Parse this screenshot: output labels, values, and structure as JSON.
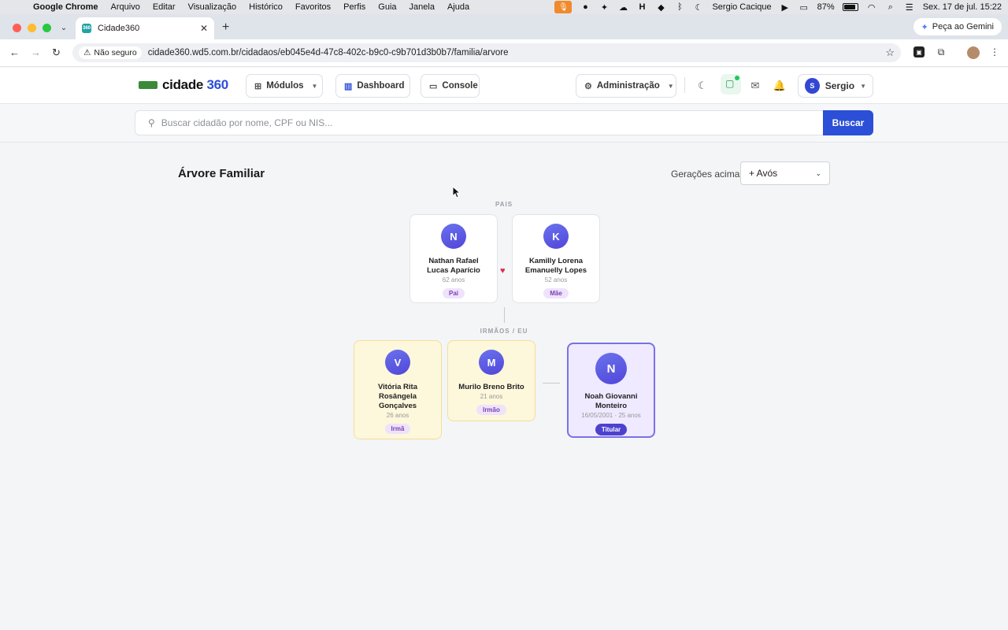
{
  "menubar": {
    "app": "Google Chrome",
    "items": [
      "Arquivo",
      "Editar",
      "Visualização",
      "Histórico",
      "Favoritos",
      "Perfis",
      "Guia",
      "Janela",
      "Ajuda"
    ],
    "user": "Sergio Cacique",
    "battery": "87%",
    "datetime": "Sex. 17 de jul.  15:22"
  },
  "browser": {
    "tab_title": "Cidade360",
    "tab_favicon": "360",
    "gemini": "Peça ao Gemini",
    "not_secure": "Não seguro",
    "url": "cidade360.wd5.com.br/cidadaos/eb045e4d-47c8-402c-b9c0-c9b701d3b0b7/familia/arvore"
  },
  "header": {
    "logo_main": "cidade",
    "logo_num": "360",
    "modules": "Módulos",
    "dashboard": "Dashboard",
    "console": "Console",
    "admin": "Administração",
    "user_initial": "S",
    "user_name": "Sergio"
  },
  "search": {
    "placeholder": "Buscar cidadão por nome, CPF ou NIS...",
    "button": "Buscar"
  },
  "tree": {
    "title": "Árvore Familiar",
    "generations_label": "Gerações acima:",
    "generations_value": "+ Avós",
    "parents_label": "PAIS",
    "siblings_label": "IRMÃOS / EU",
    "parents": [
      {
        "initial": "N",
        "name": "Nathan Rafael Lucas Aparício",
        "age": "62 anos",
        "role": "Pai"
      },
      {
        "initial": "K",
        "name": "Kamilly Lorena Emanuelly Lopes",
        "age": "52 anos",
        "role": "Mãe"
      }
    ],
    "siblings": [
      {
        "initial": "V",
        "name": "Vitória Rita Rosângela Gonçalves",
        "age": "26 anos",
        "role": "Irmã"
      },
      {
        "initial": "M",
        "name": "Murilo Breno Brito",
        "age": "21 anos",
        "role": "Irmão"
      }
    ],
    "holder": {
      "initial": "N",
      "name": "Noah Giovanni Monteiro",
      "age": "16/05/2001 · 25 anos",
      "role": "Titular"
    }
  },
  "colors": {
    "accent": "#2b4fd6",
    "avatar": "#5a5fe3",
    "sibling_card": "#fdf7dc",
    "holder_card": "#efeaff",
    "heart": "#e0294f"
  }
}
